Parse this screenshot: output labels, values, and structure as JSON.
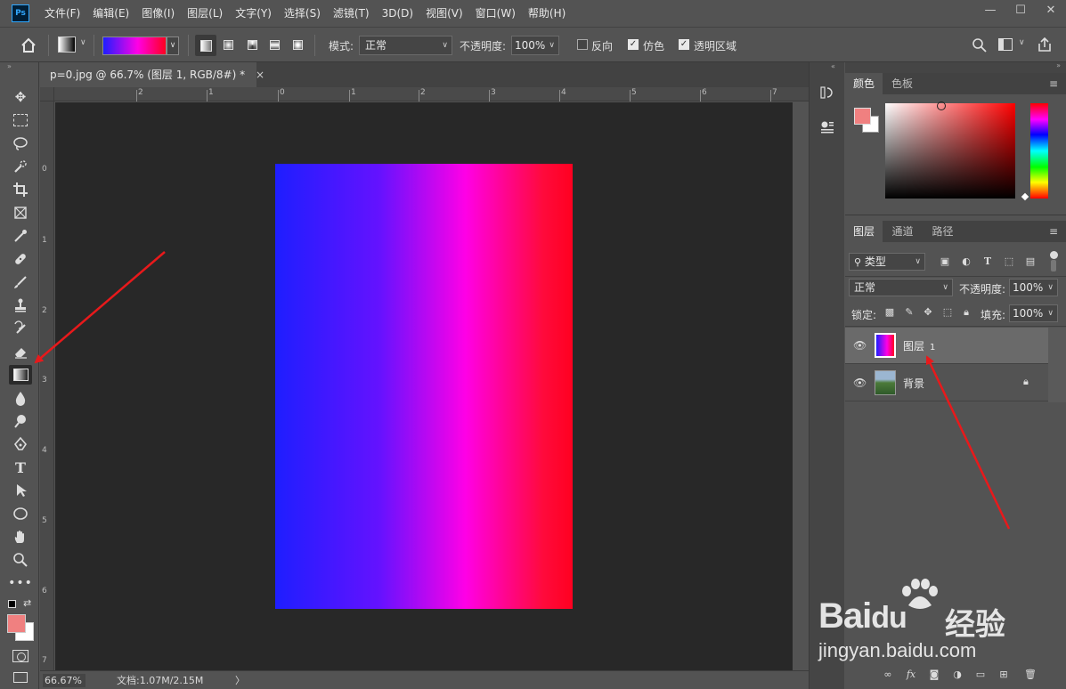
{
  "app": {
    "logo_text": "Ps",
    "menus": [
      "文件(F)",
      "编辑(E)",
      "图像(I)",
      "图层(L)",
      "文字(Y)",
      "选择(S)",
      "滤镜(T)",
      "3D(D)",
      "视图(V)",
      "窗口(W)",
      "帮助(H)"
    ],
    "window_controls": {
      "minimize": "—",
      "maximize": "☐",
      "close": "✕"
    }
  },
  "options_bar": {
    "mode_label": "模式:",
    "mode_value": "正常",
    "opacity_label": "不透明度:",
    "opacity_value": "100%",
    "reverse_label": "反向",
    "reverse_checked": false,
    "dither_label": "仿色",
    "dither_checked": true,
    "transparency_label": "透明区域",
    "transparency_checked": true
  },
  "document": {
    "tab_title": "p=0.jpg @ 66.7% (图层 1, RGB/8#) *",
    "tab_close": "×",
    "ruler_h": [
      "2",
      "1",
      "0",
      "1",
      "2",
      "3",
      "4",
      "5",
      "6",
      "7"
    ],
    "ruler_v": [
      "0",
      "1",
      "2",
      "3",
      "4",
      "5",
      "6",
      "7"
    ],
    "gradient_colors": [
      "#1e1eff",
      "#6412ff",
      "#ff00e6",
      "#ff0a3c",
      "#ff0020"
    ]
  },
  "status_bar": {
    "zoom": "66.67%",
    "doc_info": "文档:1.07M/2.15M",
    "arrow": "〉"
  },
  "tools": {
    "foreground_color": "#f08080",
    "background_color": "#ffffff"
  },
  "color_panel": {
    "tabs": [
      "颜色",
      "色板"
    ],
    "menu_icon": "≡"
  },
  "layers_panel": {
    "tabs": [
      "图层",
      "通道",
      "路径"
    ],
    "menu_icon": "≡",
    "filter_value": "类型",
    "blend_mode": "正常",
    "opacity_label": "不透明度:",
    "opacity_value": "100%",
    "lock_label": "锁定:",
    "fill_label": "填充:",
    "fill_value": "100%",
    "layers": [
      {
        "name": "图层",
        "suffix": "1",
        "selected": true
      },
      {
        "name": "背景",
        "suffix": "",
        "selected": false,
        "locked": true
      }
    ]
  },
  "watermark": {
    "brand": "Bai",
    "brand2": "du",
    "cn": "经验",
    "url": "jingyan.baidu.com"
  },
  "annotation_color": "#e8191b"
}
